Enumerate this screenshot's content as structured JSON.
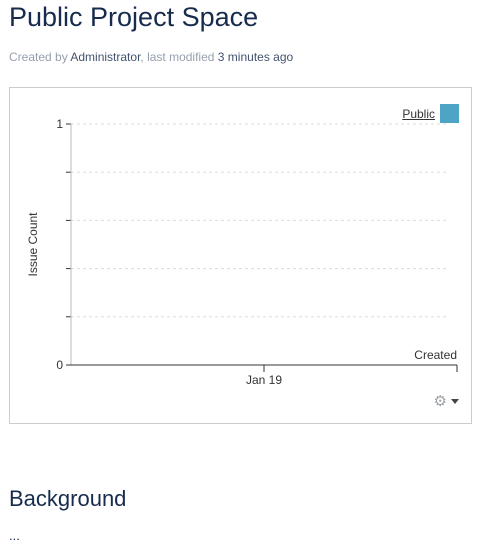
{
  "page": {
    "title": "Public Project Space",
    "meta": {
      "created_by_label": "Created by",
      "author": "Administrator",
      "modified_label": ", last modified",
      "modified_time": "3 minutes ago"
    }
  },
  "chart_data": {
    "type": "bar",
    "categories": [
      "Jan 19"
    ],
    "series": [
      {
        "name": "Public",
        "values": [
          0
        ]
      }
    ],
    "xlabel": "Created",
    "ylabel": "Issue Count",
    "ylim": [
      0,
      1
    ],
    "yticks": [
      "0",
      "1"
    ],
    "grid": true,
    "legend_position": "top-right",
    "colors": {
      "Public": "#4ea4c5"
    }
  },
  "chart_controls": {
    "gear_icon": "gear-icon",
    "caret_icon": "chevron-down-icon"
  },
  "background_section": {
    "heading": "Background",
    "body": "..."
  }
}
